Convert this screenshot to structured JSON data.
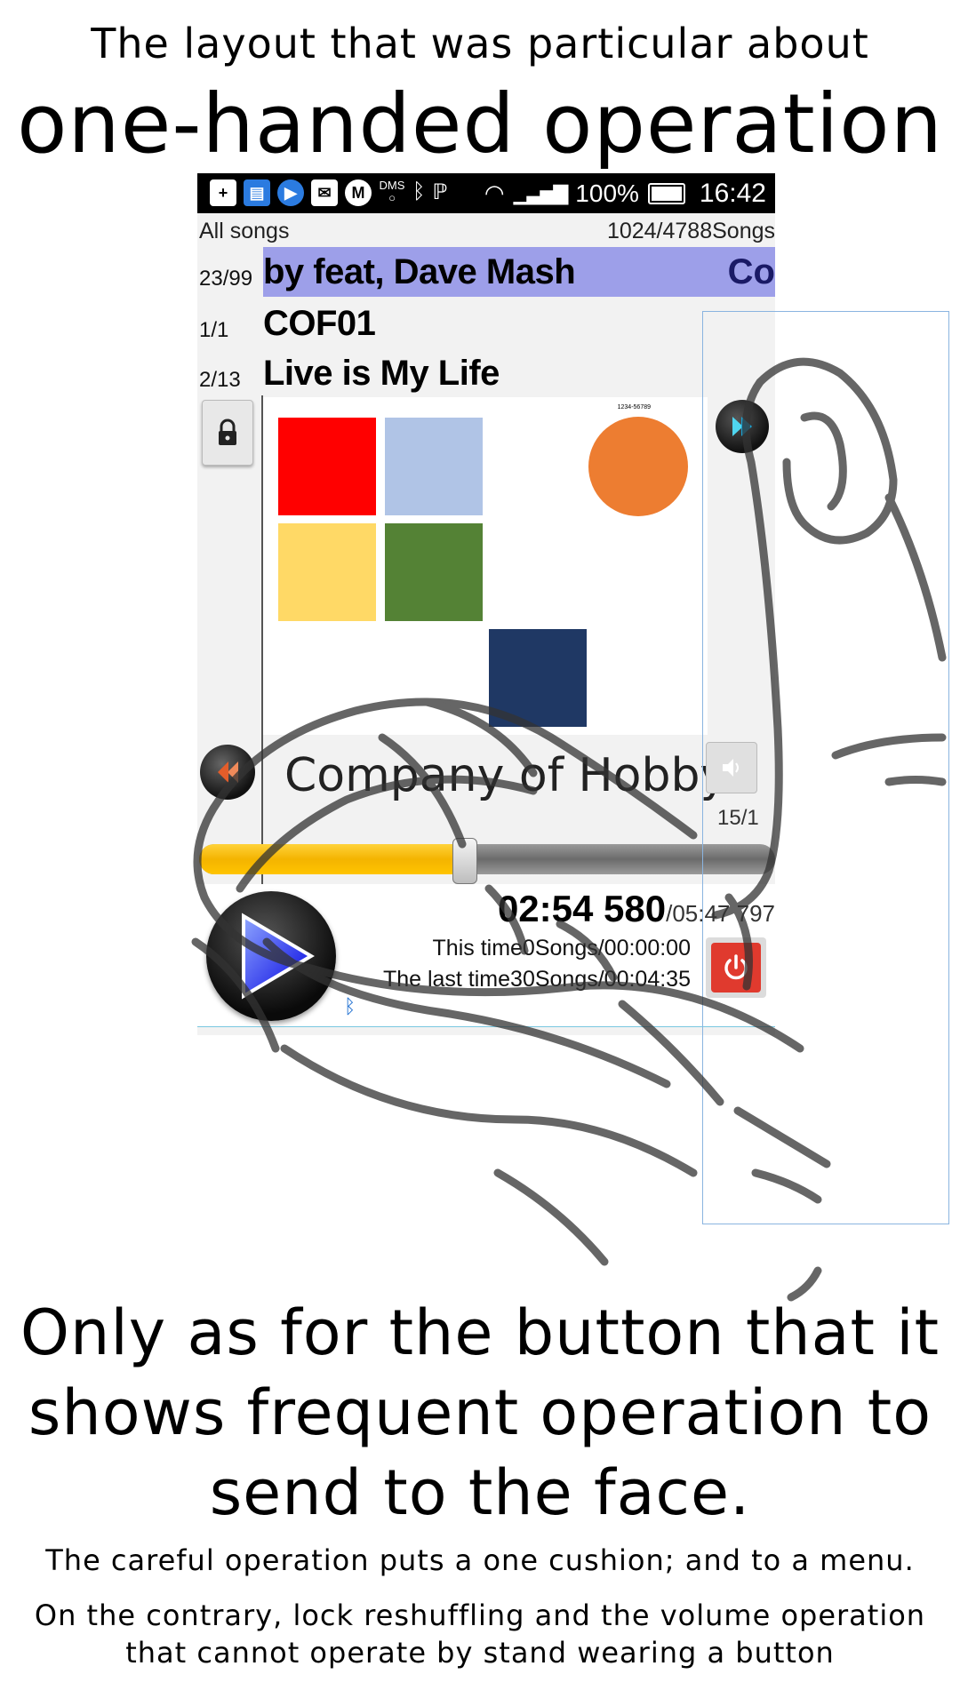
{
  "headline": {
    "line1": "The layout that was particular about",
    "line2": "one-handed operation"
  },
  "statusbar": {
    "dms": "DMS",
    "battery": "100%",
    "time": "16:42"
  },
  "list_header": {
    "left": "All songs",
    "right": "1024/4788Songs"
  },
  "rows": [
    {
      "count": "23/99",
      "title": "by feat, Dave Mash",
      "title_right": "Co",
      "selected": true
    },
    {
      "count": "1/1",
      "title": "COF01",
      "selected": false
    },
    {
      "count": "2/13",
      "title": "Live is My Life",
      "selected": false
    }
  ],
  "album_art": {
    "number_text": "1234-56789",
    "colors": {
      "red": "#ff0000",
      "light_blue": "#b0c4e6",
      "yellow": "#ffd966",
      "green": "#548235",
      "navy": "#1f3864",
      "orange": "#ed7d31"
    }
  },
  "player": {
    "artist": "Company of Hobby",
    "page_right": "15/1",
    "progress": 0.46,
    "elapsed": "02:54 580",
    "total": "/05:47 797",
    "this_time": "This time0Songs/00:00:00",
    "last_time": "The last time30Songs/00:04:35"
  },
  "colors": {
    "selected_row": "#9d9fe9",
    "progress_fill": "#f4b400",
    "power_red": "#e03a2e",
    "play_blue": "#1030ff"
  },
  "icons": [
    "plus-icon",
    "sd-card-icon",
    "play-icon",
    "mail-icon",
    "m-icon",
    "dms-icon",
    "bluetooth-icon",
    "nfc-icon",
    "wifi-icon",
    "signal-icon",
    "battery-icon",
    "lock-icon",
    "rewind-icon",
    "skip-forward-icon",
    "volume-icon",
    "power-icon",
    "play-button-icon",
    "bluetooth-small-icon"
  ],
  "caption": {
    "big_line1": "Only as for the button that it",
    "big_line2": "shows frequent operation to",
    "big_line3": "send to the face.",
    "small1": "The careful operation puts a one cushion; and to a menu.",
    "small2_line1": "On the contrary, lock reshuffling and the volume operation",
    "small2_line2": "that cannot operate by stand wearing a button"
  }
}
